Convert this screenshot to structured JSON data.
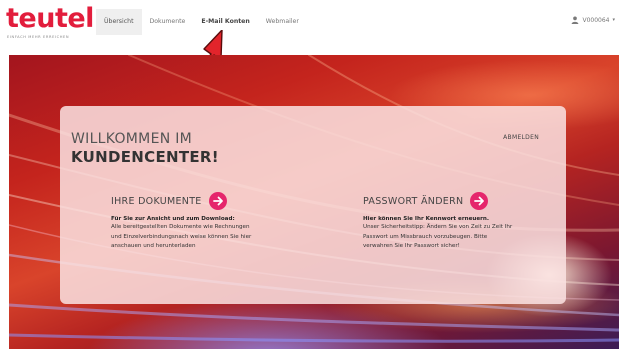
{
  "header": {
    "logo_text": "teutel",
    "logo_tagline": "EINFACH MEHR ERREICHEN",
    "nav": [
      {
        "label": "Übersicht"
      },
      {
        "label": "Dokumente"
      },
      {
        "label": "E-Mail Konten"
      },
      {
        "label": "Webmailer"
      }
    ],
    "user": {
      "label": "V000064"
    }
  },
  "panel": {
    "welcome_line1": "WILLKOMMEN IM",
    "welcome_line2": "KUNDENCENTER!",
    "logout_label": "ABMELDEN",
    "documents": {
      "title": "IHRE DOKUMENTE",
      "lead": "Für Sie zur Ansicht und zum Download:",
      "text": "Alle bereitgestellten Dokumente wie Rechnungen und Einzelverbindungsnach weise können Sie hier anschauen und herunterladen"
    },
    "password": {
      "title": "PASSWORT ÄNDERN",
      "lead": "Hier können Sie Ihr Kennwort erneuern.",
      "text": "Unser Sicherheitstipp: Ändern Sie von Zeit zu Zeit Ihr Passwort um Missbrauch vorzubeugen. Bitte verwahren Sie Ihr Passwort sicher!"
    }
  },
  "colors": {
    "brand": "#e21d3c",
    "accent_button": "#e5266c",
    "annotation_arrow": "#e2242b"
  },
  "icons": {
    "user": "user-icon",
    "dropdown": "caret-down-icon",
    "documents_button": "arrow-right-icon",
    "password_button": "arrow-right-icon",
    "annotation": "red-arrow-icon"
  }
}
